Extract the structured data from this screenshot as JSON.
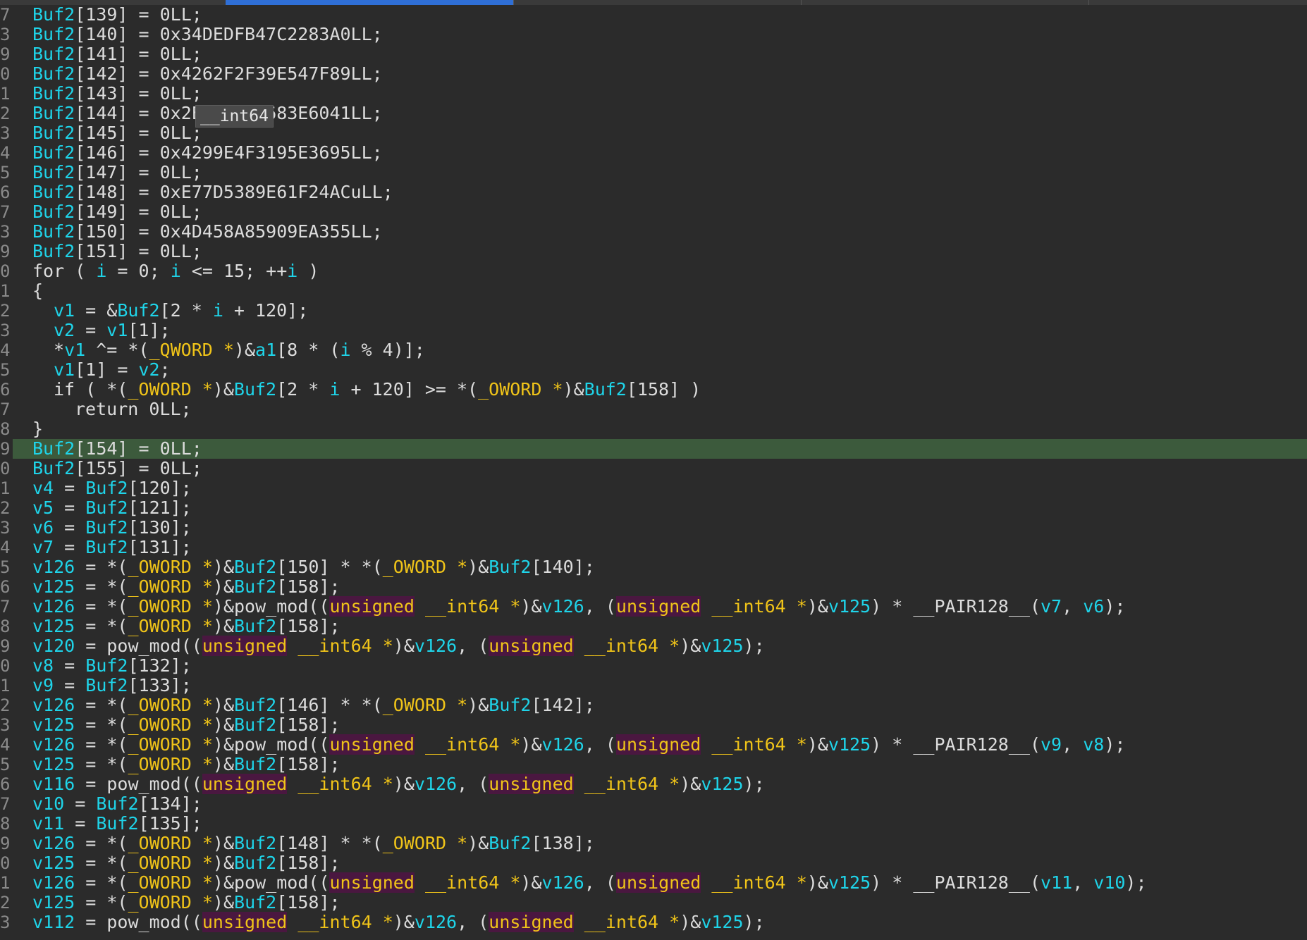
{
  "tooltip": {
    "text": "__int64"
  },
  "gutter": [
    "7",
    "3",
    "9",
    "0",
    "1",
    "2",
    "3",
    "4",
    "5",
    "6",
    "7",
    "3",
    "9",
    "0",
    "1",
    "2",
    "3",
    "4",
    "5",
    "6",
    "7",
    "8",
    "9",
    "0",
    "1",
    "2",
    "3",
    "4",
    "5",
    "6",
    "7",
    "8",
    "9",
    "0",
    "1",
    "2",
    "3",
    "4",
    "5",
    "6",
    "7",
    "8",
    "9",
    "0",
    "1",
    "2",
    "3"
  ],
  "code_lines": [
    {
      "indent": 0,
      "highlight": false,
      "tokens": [
        [
          "v",
          "Buf2"
        ],
        [
          "t",
          "[139] = 0LL;"
        ]
      ]
    },
    {
      "indent": 0,
      "highlight": false,
      "tokens": [
        [
          "v",
          "Buf2"
        ],
        [
          "t",
          "[140] = 0x34DEDFB47C2283A0LL;"
        ]
      ]
    },
    {
      "indent": 0,
      "highlight": false,
      "tokens": [
        [
          "v",
          "Buf2"
        ],
        [
          "t",
          "[141] = 0LL;"
        ]
      ]
    },
    {
      "indent": 0,
      "highlight": false,
      "tokens": [
        [
          "v",
          "Buf2"
        ],
        [
          "t",
          "[142] = 0x4262F2F39E547F89LL;"
        ]
      ]
    },
    {
      "indent": 0,
      "highlight": false,
      "tokens": [
        [
          "v",
          "Buf2"
        ],
        [
          "t",
          "[143] = 0LL;"
        ]
      ]
    },
    {
      "indent": 0,
      "highlight": false,
      "tokens": [
        [
          "v",
          "Buf2"
        ],
        [
          "t",
          "[144] = 0x2EAC8722683E6041LL;"
        ]
      ]
    },
    {
      "indent": 0,
      "highlight": false,
      "tokens": [
        [
          "v",
          "Buf2"
        ],
        [
          "t",
          "[145] = 0LL;"
        ]
      ]
    },
    {
      "indent": 0,
      "highlight": false,
      "tokens": [
        [
          "v",
          "Buf2"
        ],
        [
          "t",
          "[146] = 0x4299E4F3195E3695LL;"
        ]
      ]
    },
    {
      "indent": 0,
      "highlight": false,
      "tokens": [
        [
          "v",
          "Buf2"
        ],
        [
          "t",
          "[147] = 0LL;"
        ]
      ]
    },
    {
      "indent": 0,
      "highlight": false,
      "tokens": [
        [
          "v",
          "Buf2"
        ],
        [
          "t",
          "[148] = 0xE77D5389E61F24ACuLL;"
        ]
      ]
    },
    {
      "indent": 0,
      "highlight": false,
      "tokens": [
        [
          "v",
          "Buf2"
        ],
        [
          "t",
          "[149] = 0LL;"
        ]
      ]
    },
    {
      "indent": 0,
      "highlight": false,
      "tokens": [
        [
          "v",
          "Buf2"
        ],
        [
          "t",
          "[150] = 0x4D458A85909EA355LL;"
        ]
      ]
    },
    {
      "indent": 0,
      "highlight": false,
      "tokens": [
        [
          "v",
          "Buf2"
        ],
        [
          "t",
          "[151] = 0LL;"
        ]
      ]
    },
    {
      "indent": 0,
      "highlight": false,
      "tokens": [
        [
          "t",
          "for ( "
        ],
        [
          "v",
          "i"
        ],
        [
          "t",
          " = 0; "
        ],
        [
          "v",
          "i"
        ],
        [
          "t",
          " <= 15; ++"
        ],
        [
          "v",
          "i"
        ],
        [
          "t",
          " )"
        ]
      ]
    },
    {
      "indent": 0,
      "highlight": false,
      "tokens": [
        [
          "t",
          "{"
        ]
      ]
    },
    {
      "indent": 1,
      "highlight": false,
      "tokens": [
        [
          "v",
          "v1"
        ],
        [
          "t",
          " = &"
        ],
        [
          "v",
          "Buf2"
        ],
        [
          "t",
          "[2 * "
        ],
        [
          "v",
          "i"
        ],
        [
          "t",
          " + 120];"
        ]
      ]
    },
    {
      "indent": 1,
      "highlight": false,
      "tokens": [
        [
          "v",
          "v2"
        ],
        [
          "t",
          " = "
        ],
        [
          "v",
          "v1"
        ],
        [
          "t",
          "[1];"
        ]
      ]
    },
    {
      "indent": 1,
      "highlight": false,
      "tokens": [
        [
          "t",
          "*"
        ],
        [
          "v",
          "v1"
        ],
        [
          "t",
          " ^= *("
        ],
        [
          "y",
          "_QWORD *"
        ],
        [
          "t",
          ")&"
        ],
        [
          "v",
          "a1"
        ],
        [
          "t",
          "[8 * ("
        ],
        [
          "v",
          "i"
        ],
        [
          "t",
          " % 4)];"
        ]
      ]
    },
    {
      "indent": 1,
      "highlight": false,
      "tokens": [
        [
          "v",
          "v1"
        ],
        [
          "t",
          "[1] = "
        ],
        [
          "v",
          "v2"
        ],
        [
          "t",
          ";"
        ]
      ]
    },
    {
      "indent": 1,
      "highlight": false,
      "tokens": [
        [
          "t",
          "if ( *("
        ],
        [
          "y",
          "_OWORD *"
        ],
        [
          "t",
          ")&"
        ],
        [
          "v",
          "Buf2"
        ],
        [
          "t",
          "[2 * "
        ],
        [
          "v",
          "i"
        ],
        [
          "t",
          " + 120] >= *("
        ],
        [
          "y",
          "_OWORD *"
        ],
        [
          "t",
          ")&"
        ],
        [
          "v",
          "Buf2"
        ],
        [
          "t",
          "[158] )"
        ]
      ]
    },
    {
      "indent": 2,
      "highlight": false,
      "tokens": [
        [
          "t",
          "return 0LL;"
        ]
      ]
    },
    {
      "indent": 0,
      "highlight": false,
      "tokens": [
        [
          "t",
          "}"
        ]
      ]
    },
    {
      "indent": 0,
      "highlight": true,
      "tokens": [
        [
          "v",
          "Buf2"
        ],
        [
          "t",
          "[154] = 0LL;"
        ]
      ]
    },
    {
      "indent": 0,
      "highlight": false,
      "tokens": [
        [
          "v",
          "Buf2"
        ],
        [
          "t",
          "[155] = 0LL;"
        ]
      ]
    },
    {
      "indent": 0,
      "highlight": false,
      "tokens": [
        [
          "v",
          "v4"
        ],
        [
          "t",
          " = "
        ],
        [
          "v",
          "Buf2"
        ],
        [
          "t",
          "[120];"
        ]
      ]
    },
    {
      "indent": 0,
      "highlight": false,
      "tokens": [
        [
          "v",
          "v5"
        ],
        [
          "t",
          " = "
        ],
        [
          "v",
          "Buf2"
        ],
        [
          "t",
          "[121];"
        ]
      ]
    },
    {
      "indent": 0,
      "highlight": false,
      "tokens": [
        [
          "v",
          "v6"
        ],
        [
          "t",
          " = "
        ],
        [
          "v",
          "Buf2"
        ],
        [
          "t",
          "[130];"
        ]
      ]
    },
    {
      "indent": 0,
      "highlight": false,
      "tokens": [
        [
          "v",
          "v7"
        ],
        [
          "t",
          " = "
        ],
        [
          "v",
          "Buf2"
        ],
        [
          "t",
          "[131];"
        ]
      ]
    },
    {
      "indent": 0,
      "highlight": false,
      "tokens": [
        [
          "v",
          "v126"
        ],
        [
          "t",
          " = *("
        ],
        [
          "y",
          "_OWORD *"
        ],
        [
          "t",
          ")&"
        ],
        [
          "v",
          "Buf2"
        ],
        [
          "t",
          "[150] * *("
        ],
        [
          "y",
          "_OWORD *"
        ],
        [
          "t",
          ")&"
        ],
        [
          "v",
          "Buf2"
        ],
        [
          "t",
          "[140];"
        ]
      ]
    },
    {
      "indent": 0,
      "highlight": false,
      "tokens": [
        [
          "v",
          "v125"
        ],
        [
          "t",
          " = *("
        ],
        [
          "y",
          "_OWORD *"
        ],
        [
          "t",
          ")&"
        ],
        [
          "v",
          "Buf2"
        ],
        [
          "t",
          "[158];"
        ]
      ]
    },
    {
      "indent": 0,
      "highlight": false,
      "tokens": [
        [
          "v",
          "v126"
        ],
        [
          "t",
          " = *("
        ],
        [
          "y",
          "_OWORD *"
        ],
        [
          "t",
          ")&pow_mod(("
        ],
        [
          "u",
          "unsigned"
        ],
        [
          "y",
          " __int64 *"
        ],
        [
          "t",
          ")&"
        ],
        [
          "v",
          "v126"
        ],
        [
          "t",
          ", ("
        ],
        [
          "u",
          "unsigned"
        ],
        [
          "y",
          " __int64 *"
        ],
        [
          "t",
          ")&"
        ],
        [
          "v",
          "v125"
        ],
        [
          "t",
          ") * __PAIR128__("
        ],
        [
          "v",
          "v7"
        ],
        [
          "t",
          ", "
        ],
        [
          "v",
          "v6"
        ],
        [
          "t",
          ");"
        ]
      ]
    },
    {
      "indent": 0,
      "highlight": false,
      "tokens": [
        [
          "v",
          "v125"
        ],
        [
          "t",
          " = *("
        ],
        [
          "y",
          "_OWORD *"
        ],
        [
          "t",
          ")&"
        ],
        [
          "v",
          "Buf2"
        ],
        [
          "t",
          "[158];"
        ]
      ]
    },
    {
      "indent": 0,
      "highlight": false,
      "tokens": [
        [
          "v",
          "v120"
        ],
        [
          "t",
          " = pow_mod(("
        ],
        [
          "u",
          "unsigned"
        ],
        [
          "y",
          " __int64 *"
        ],
        [
          "t",
          ")&"
        ],
        [
          "v",
          "v126"
        ],
        [
          "t",
          ", ("
        ],
        [
          "u",
          "unsigned"
        ],
        [
          "y",
          " __int64 *"
        ],
        [
          "t",
          ")&"
        ],
        [
          "v",
          "v125"
        ],
        [
          "t",
          ");"
        ]
      ]
    },
    {
      "indent": 0,
      "highlight": false,
      "tokens": [
        [
          "v",
          "v8"
        ],
        [
          "t",
          " = "
        ],
        [
          "v",
          "Buf2"
        ],
        [
          "t",
          "[132];"
        ]
      ]
    },
    {
      "indent": 0,
      "highlight": false,
      "tokens": [
        [
          "v",
          "v9"
        ],
        [
          "t",
          " = "
        ],
        [
          "v",
          "Buf2"
        ],
        [
          "t",
          "[133];"
        ]
      ]
    },
    {
      "indent": 0,
      "highlight": false,
      "tokens": [
        [
          "v",
          "v126"
        ],
        [
          "t",
          " = *("
        ],
        [
          "y",
          "_OWORD *"
        ],
        [
          "t",
          ")&"
        ],
        [
          "v",
          "Buf2"
        ],
        [
          "t",
          "[146] * *("
        ],
        [
          "y",
          "_OWORD *"
        ],
        [
          "t",
          ")&"
        ],
        [
          "v",
          "Buf2"
        ],
        [
          "t",
          "[142];"
        ]
      ]
    },
    {
      "indent": 0,
      "highlight": false,
      "tokens": [
        [
          "v",
          "v125"
        ],
        [
          "t",
          " = *("
        ],
        [
          "y",
          "_OWORD *"
        ],
        [
          "t",
          ")&"
        ],
        [
          "v",
          "Buf2"
        ],
        [
          "t",
          "[158];"
        ]
      ]
    },
    {
      "indent": 0,
      "highlight": false,
      "tokens": [
        [
          "v",
          "v126"
        ],
        [
          "t",
          " = *("
        ],
        [
          "y",
          "_OWORD *"
        ],
        [
          "t",
          ")&pow_mod(("
        ],
        [
          "u",
          "unsigned"
        ],
        [
          "y",
          " __int64 *"
        ],
        [
          "t",
          ")&"
        ],
        [
          "v",
          "v126"
        ],
        [
          "t",
          ", ("
        ],
        [
          "u",
          "unsigned"
        ],
        [
          "y",
          " __int64 *"
        ],
        [
          "t",
          ")&"
        ],
        [
          "v",
          "v125"
        ],
        [
          "t",
          ") * __PAIR128__("
        ],
        [
          "v",
          "v9"
        ],
        [
          "t",
          ", "
        ],
        [
          "v",
          "v8"
        ],
        [
          "t",
          ");"
        ]
      ]
    },
    {
      "indent": 0,
      "highlight": false,
      "tokens": [
        [
          "v",
          "v125"
        ],
        [
          "t",
          " = *("
        ],
        [
          "y",
          "_OWORD *"
        ],
        [
          "t",
          ")&"
        ],
        [
          "v",
          "Buf2"
        ],
        [
          "t",
          "[158];"
        ]
      ]
    },
    {
      "indent": 0,
      "highlight": false,
      "tokens": [
        [
          "v",
          "v116"
        ],
        [
          "t",
          " = pow_mod(("
        ],
        [
          "u",
          "unsigned"
        ],
        [
          "y",
          " __int64 *"
        ],
        [
          "t",
          ")&"
        ],
        [
          "v",
          "v126"
        ],
        [
          "t",
          ", ("
        ],
        [
          "u",
          "unsigned"
        ],
        [
          "y",
          " __int64 *"
        ],
        [
          "t",
          ")&"
        ],
        [
          "v",
          "v125"
        ],
        [
          "t",
          ");"
        ]
      ]
    },
    {
      "indent": 0,
      "highlight": false,
      "tokens": [
        [
          "v",
          "v10"
        ],
        [
          "t",
          " = "
        ],
        [
          "v",
          "Buf2"
        ],
        [
          "t",
          "[134];"
        ]
      ]
    },
    {
      "indent": 0,
      "highlight": false,
      "tokens": [
        [
          "v",
          "v11"
        ],
        [
          "t",
          " = "
        ],
        [
          "v",
          "Buf2"
        ],
        [
          "t",
          "[135];"
        ]
      ]
    },
    {
      "indent": 0,
      "highlight": false,
      "tokens": [
        [
          "v",
          "v126"
        ],
        [
          "t",
          " = *("
        ],
        [
          "y",
          "_OWORD *"
        ],
        [
          "t",
          ")&"
        ],
        [
          "v",
          "Buf2"
        ],
        [
          "t",
          "[148] * *("
        ],
        [
          "y",
          "_OWORD *"
        ],
        [
          "t",
          ")&"
        ],
        [
          "v",
          "Buf2"
        ],
        [
          "t",
          "[138];"
        ]
      ]
    },
    {
      "indent": 0,
      "highlight": false,
      "tokens": [
        [
          "v",
          "v125"
        ],
        [
          "t",
          " = *("
        ],
        [
          "y",
          "_OWORD *"
        ],
        [
          "t",
          ")&"
        ],
        [
          "v",
          "Buf2"
        ],
        [
          "t",
          "[158];"
        ]
      ]
    },
    {
      "indent": 0,
      "highlight": false,
      "tokens": [
        [
          "v",
          "v126"
        ],
        [
          "t",
          " = *("
        ],
        [
          "y",
          "_OWORD *"
        ],
        [
          "t",
          ")&pow_mod(("
        ],
        [
          "u",
          "unsigned"
        ],
        [
          "y",
          " __int64 *"
        ],
        [
          "t",
          ")&"
        ],
        [
          "v",
          "v126"
        ],
        [
          "t",
          ", ("
        ],
        [
          "u",
          "unsigned"
        ],
        [
          "y",
          " __int64 *"
        ],
        [
          "t",
          ")&"
        ],
        [
          "v",
          "v125"
        ],
        [
          "t",
          ") * __PAIR128__("
        ],
        [
          "v",
          "v11"
        ],
        [
          "t",
          ", "
        ],
        [
          "v",
          "v10"
        ],
        [
          "t",
          ");"
        ]
      ]
    },
    {
      "indent": 0,
      "highlight": false,
      "tokens": [
        [
          "v",
          "v125"
        ],
        [
          "t",
          " = *("
        ],
        [
          "y",
          "_OWORD *"
        ],
        [
          "t",
          ")&"
        ],
        [
          "v",
          "Buf2"
        ],
        [
          "t",
          "[158];"
        ]
      ]
    },
    {
      "indent": 0,
      "highlight": false,
      "tokens": [
        [
          "v",
          "v112"
        ],
        [
          "t",
          " = pow_mod(("
        ],
        [
          "u",
          "unsigned"
        ],
        [
          "y",
          " __int64 *"
        ],
        [
          "t",
          ")&"
        ],
        [
          "v",
          "v126"
        ],
        [
          "t",
          ", ("
        ],
        [
          "u",
          "unsigned"
        ],
        [
          "y",
          " __int64 *"
        ],
        [
          "t",
          ")&"
        ],
        [
          "v",
          "v125"
        ],
        [
          "t",
          ");"
        ]
      ]
    }
  ]
}
